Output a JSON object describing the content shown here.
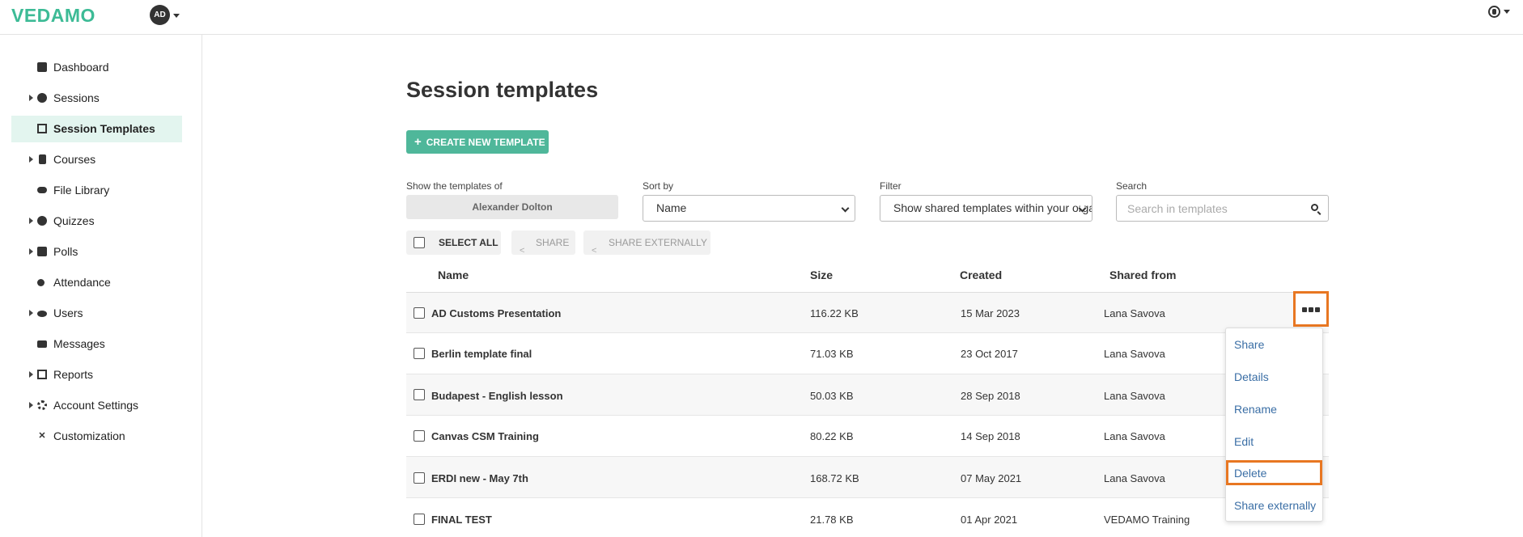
{
  "app": {
    "logo": "VEDAMO",
    "avatar_initials": "AD"
  },
  "sidebar": {
    "items": [
      {
        "label": "Dashboard",
        "icon": "dashboard-icon",
        "expandable": false,
        "active": false
      },
      {
        "label": "Sessions",
        "icon": "play-circle-icon",
        "expandable": true,
        "active": false
      },
      {
        "label": "Session Templates",
        "icon": "template-icon",
        "expandable": false,
        "active": true
      },
      {
        "label": "Courses",
        "icon": "book-icon",
        "expandable": true,
        "active": false
      },
      {
        "label": "File Library",
        "icon": "cloud-icon",
        "expandable": false,
        "active": false
      },
      {
        "label": "Quizzes",
        "icon": "question-icon",
        "expandable": true,
        "active": false
      },
      {
        "label": "Polls",
        "icon": "poll-icon",
        "expandable": true,
        "active": false
      },
      {
        "label": "Attendance",
        "icon": "attendance-icon",
        "expandable": false,
        "active": false
      },
      {
        "label": "Users",
        "icon": "users-icon",
        "expandable": true,
        "active": false
      },
      {
        "label": "Messages",
        "icon": "envelope-icon",
        "expandable": false,
        "active": false
      },
      {
        "label": "Reports",
        "icon": "report-icon",
        "expandable": true,
        "active": false
      },
      {
        "label": "Account Settings",
        "icon": "gear-icon",
        "expandable": true,
        "active": false
      },
      {
        "label": "Customization",
        "icon": "tools-icon",
        "expandable": false,
        "active": false
      }
    ]
  },
  "main": {
    "title": "Session templates",
    "create_button": "CREATE NEW TEMPLATE",
    "owner": {
      "label": "Show the templates of",
      "value": "Alexander Dolton"
    },
    "sort": {
      "label": "Sort by",
      "value": "Name"
    },
    "filter": {
      "label": "Filter",
      "value": "Show shared templates within your organization"
    },
    "search": {
      "label": "Search",
      "placeholder": "Search in templates"
    },
    "bulk": {
      "select_all": "SELECT ALL",
      "share": "SHARE",
      "share_externally": "SHARE EXTERNALLY"
    },
    "columns": {
      "name": "Name",
      "size": "Size",
      "created": "Created",
      "shared_from": "Shared from"
    },
    "rows": [
      {
        "name": "AD Customs Presentation",
        "size": "116.22 KB",
        "created": "15 Mar 2023",
        "shared_from": "Lana Savova"
      },
      {
        "name": "Berlin template final",
        "size": "71.03 KB",
        "created": "23 Oct 2017",
        "shared_from": "Lana Savova"
      },
      {
        "name": "Budapest - English lesson",
        "size": "50.03 KB",
        "created": "28 Sep 2018",
        "shared_from": "Lana Savova"
      },
      {
        "name": "Canvas CSM Training",
        "size": "80.22 KB",
        "created": "14 Sep 2018",
        "shared_from": "Lana Savova"
      },
      {
        "name": "ERDI new - May 7th",
        "size": "168.72 KB",
        "created": "07 May 2021",
        "shared_from": "Lana Savova"
      },
      {
        "name": "FINAL TEST",
        "size": "21.78 KB",
        "created": "01 Apr 2021",
        "shared_from": "VEDAMO Training"
      }
    ],
    "context_menu": [
      "Share",
      "Details",
      "Rename",
      "Edit",
      "Delete",
      "Share externally"
    ]
  },
  "colors": {
    "brand": "#3dbb96",
    "button": "#4fb79a",
    "highlight": "#e87722",
    "link": "#3a6ea5",
    "active_nav": "#e3f5ef"
  }
}
